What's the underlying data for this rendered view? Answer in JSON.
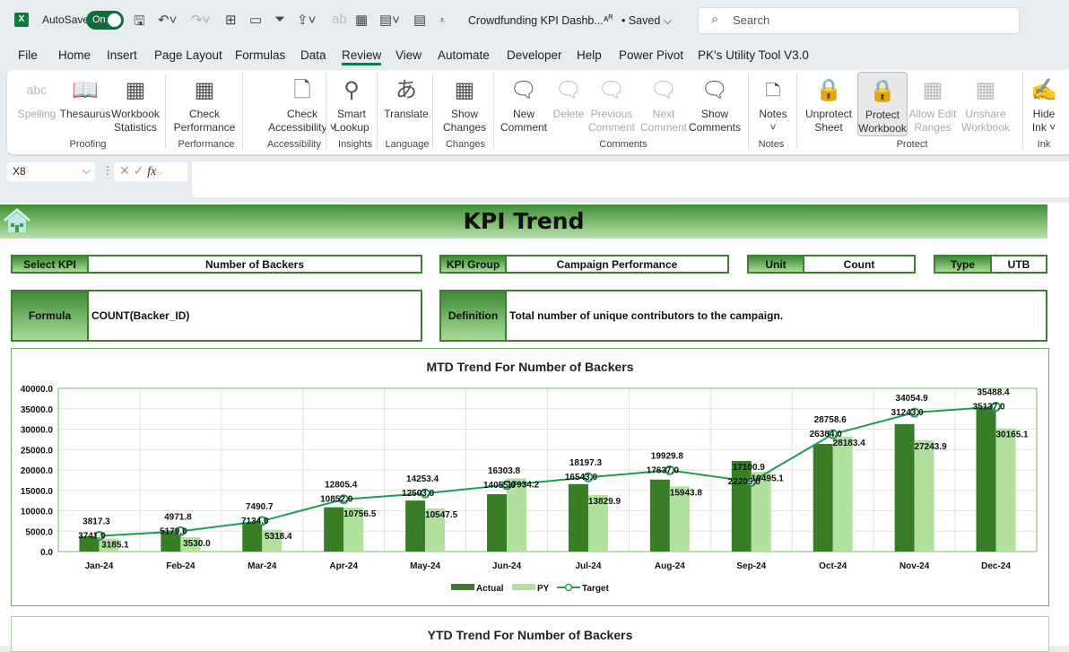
{
  "titlebar": {
    "app_icon": "excel-icon",
    "autosave_label": "AutoSave",
    "autosave_state": "On",
    "document_title": "Crowdfunding KPI Dashb...",
    "saved_status": "• Saved",
    "search_placeholder": "Search"
  },
  "menu": [
    "File",
    "Home",
    "Insert",
    "Page Layout",
    "Formulas",
    "Data",
    "Review",
    "View",
    "Automate",
    "Developer",
    "Help",
    "Power Pivot",
    "PK's Utility Tool V3.0"
  ],
  "active_menu": "Review",
  "ribbon": {
    "buttons": [
      {
        "label": "Spelling",
        "icon": "spelling-icon",
        "disabled": true
      },
      {
        "label": "Thesaurus",
        "icon": "thesaurus-icon"
      },
      {
        "label": "Workbook Statistics",
        "icon": "workbook-statistics-icon"
      },
      {
        "label": "Check Performance",
        "icon": "check-performance-icon"
      },
      {
        "label": "Check Accessibility ˅",
        "icon": "check-accessibility-icon"
      },
      {
        "label": "Smart Lookup",
        "icon": "smart-lookup-icon"
      },
      {
        "label": "Translate",
        "icon": "translate-icon"
      },
      {
        "label": "Show Changes",
        "icon": "show-changes-icon"
      },
      {
        "label": "New Comment",
        "icon": "new-comment-icon"
      },
      {
        "label": "Delete",
        "icon": "delete-comment-icon",
        "disabled": true
      },
      {
        "label": "Previous Comment",
        "icon": "previous-comment-icon",
        "disabled": true
      },
      {
        "label": "Next Comment",
        "icon": "next-comment-icon",
        "disabled": true
      },
      {
        "label": "Show Comments",
        "icon": "show-comments-icon"
      },
      {
        "label": "Notes ˅",
        "icon": "notes-icon"
      },
      {
        "label": "Unprotect Sheet",
        "icon": "unprotect-sheet-icon"
      },
      {
        "label": "Protect Workbook",
        "icon": "protect-workbook-icon",
        "selected": true
      },
      {
        "label": "Allow Edit Ranges",
        "icon": "allow-edit-ranges-icon",
        "disabled": true
      },
      {
        "label": "Unshare Workbook",
        "icon": "unshare-workbook-icon",
        "disabled": true
      },
      {
        "label": "Hide Ink ˅",
        "icon": "hide-ink-icon"
      }
    ],
    "groups": [
      "Proofing",
      "Performance",
      "Accessibility",
      "Insights",
      "Language",
      "Changes",
      "Comments",
      "Notes",
      "Protect",
      "Ink"
    ]
  },
  "formula_bar": {
    "name_box": "X8",
    "formula": ""
  },
  "sheet": {
    "title": "KPI Trend",
    "select_kpi_label": "Select KPI",
    "select_kpi_value": "Number of Backers",
    "kpi_group_label": "KPI Group",
    "kpi_group_value": "Campaign Performance",
    "unit_label": "Unit",
    "unit_value": "Count",
    "type_label": "Type",
    "type_value": "UTB",
    "formula_label": "Formula",
    "formula_value": "COUNT(Backer_ID)",
    "definition_label": "Definition",
    "definition_value": "Total number of unique contributors to the campaign."
  },
  "chart_data": [
    {
      "type": "bar",
      "title": "MTD Trend For Number of Backers",
      "categories": [
        "Jan-24",
        "Feb-24",
        "Mar-24",
        "Apr-24",
        "May-24",
        "Jun-24",
        "Jul-24",
        "Aug-24",
        "Sep-24",
        "Oct-24",
        "Nov-24",
        "Dec-24"
      ],
      "ylim": [
        0,
        40000
      ],
      "yticks": [
        "0.0",
        "5000.0",
        "10000.0",
        "15000.0",
        "20000.0",
        "25000.0",
        "30000.0",
        "35000.0",
        "40000.0"
      ],
      "grid": true,
      "legend_position": "bottom",
      "series": [
        {
          "name": "Actual",
          "type": "bar",
          "color": "#3a7d27",
          "values": [
            3741.0,
            5179.0,
            7134.0,
            10852.0,
            12503.0,
            14055.0,
            16543.0,
            17637.0,
            22209.0,
            26384.0,
            31243.0,
            35137.0
          ]
        },
        {
          "name": "PY",
          "type": "bar",
          "color": "#b2e09e",
          "values": [
            3185.1,
            3530.0,
            5318.4,
            10756.5,
            10547.5,
            17934.2,
            13829.9,
            15943.8,
            19495.1,
            28183.4,
            27243.9,
            30165.1
          ]
        },
        {
          "name": "Target",
          "type": "line",
          "color": "#1f9d55",
          "values": [
            3817.3,
            4971.8,
            7490.7,
            12805.4,
            14253.4,
            16303.8,
            18197.3,
            19929.8,
            17100.9,
            28758.6,
            34054.9,
            35488.4
          ]
        }
      ]
    },
    {
      "type": "bar",
      "title": "YTD Trend For Number of Backers"
    }
  ]
}
